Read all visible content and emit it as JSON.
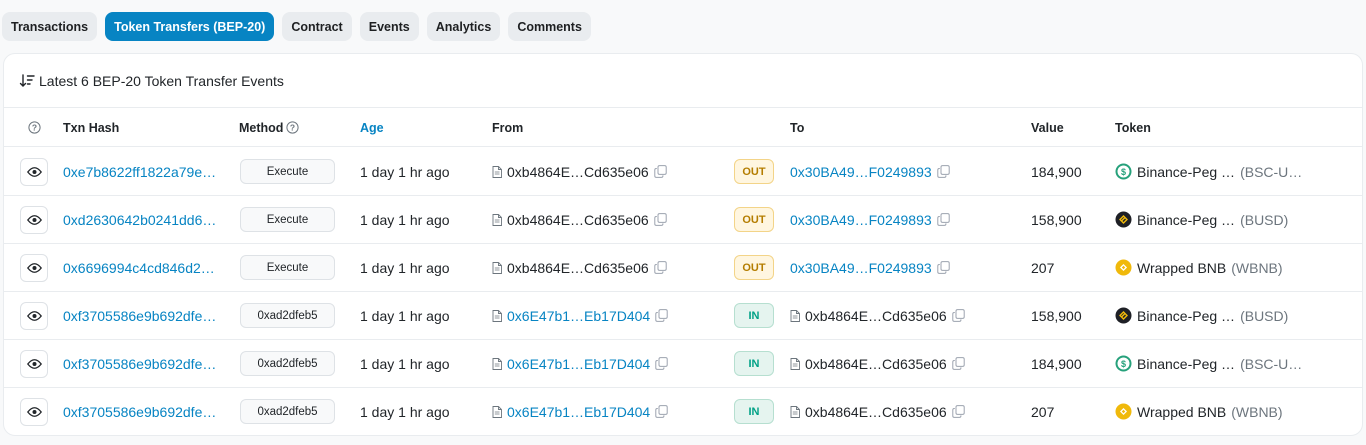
{
  "tabs": [
    {
      "label": "Transactions",
      "active": false
    },
    {
      "label": "Token Transfers (BEP-20)",
      "active": true
    },
    {
      "label": "Contract",
      "active": false
    },
    {
      "label": "Events",
      "active": false
    },
    {
      "label": "Analytics",
      "active": false
    },
    {
      "label": "Comments",
      "active": false
    }
  ],
  "header": {
    "title": "Latest 6 BEP-20 Token Transfer Events",
    "icon": "sort-desc-icon"
  },
  "columns": {
    "help": "?",
    "txn_hash": "Txn Hash",
    "method": "Method",
    "age": "Age",
    "from": "From",
    "to": "To",
    "value": "Value",
    "token": "Token"
  },
  "colors": {
    "accent": "#0784c3",
    "out": "#b47d00",
    "in": "#00a186"
  },
  "rows": [
    {
      "hash": "0xe7b8622ff1822a79e…",
      "method": "Execute",
      "age": "1 day 1 hr ago",
      "from": "0xb4864E…Cd635e06",
      "direction": "OUT",
      "to": "0x30BA49…F0249893",
      "value": "184,900",
      "token_name": "Binance-Peg …",
      "token_symbol": "(BSC-U…",
      "token_icon": "usdt"
    },
    {
      "hash": "0xd2630642b0241dd6…",
      "method": "Execute",
      "age": "1 day 1 hr ago",
      "from": "0xb4864E…Cd635e06",
      "direction": "OUT",
      "to": "0x30BA49…F0249893",
      "value": "158,900",
      "token_name": "Binance-Peg …",
      "token_symbol": "(BUSD)",
      "token_icon": "busd"
    },
    {
      "hash": "0x6696994c4cd846d2…",
      "method": "Execute",
      "age": "1 day 1 hr ago",
      "from": "0xb4864E…Cd635e06",
      "direction": "OUT",
      "to": "0x30BA49…F0249893",
      "value": "207",
      "token_name": "Wrapped BNB",
      "token_symbol": "(WBNB)",
      "token_icon": "wbnb"
    },
    {
      "hash": "0xf3705586e9b692dfe…",
      "method": "0xad2dfeb5",
      "age": "1 day 1 hr ago",
      "from": "0x6E47b1…Eb17D404",
      "direction": "IN",
      "to": "0xb4864E…Cd635e06",
      "value": "158,900",
      "token_name": "Binance-Peg …",
      "token_symbol": "(BUSD)",
      "token_icon": "busd"
    },
    {
      "hash": "0xf3705586e9b692dfe…",
      "method": "0xad2dfeb5",
      "age": "1 day 1 hr ago",
      "from": "0x6E47b1…Eb17D404",
      "direction": "IN",
      "to": "0xb4864E…Cd635e06",
      "value": "184,900",
      "token_name": "Binance-Peg …",
      "token_symbol": "(BSC-U…",
      "token_icon": "usdt"
    },
    {
      "hash": "0xf3705586e9b692dfe…",
      "method": "0xad2dfeb5",
      "age": "1 day 1 hr ago",
      "from": "0x6E47b1…Eb17D404",
      "direction": "IN",
      "to": "0xb4864E…Cd635e06",
      "value": "207",
      "token_name": "Wrapped BNB",
      "token_symbol": "(WBNB)",
      "token_icon": "wbnb"
    }
  ]
}
